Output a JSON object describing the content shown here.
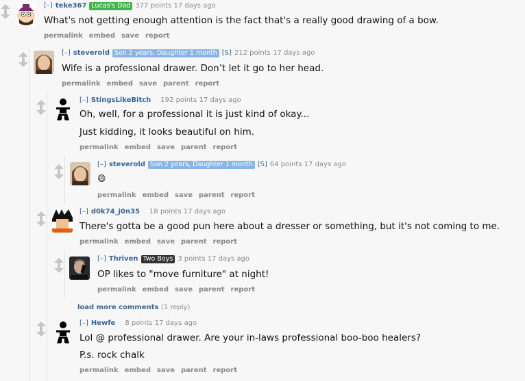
{
  "actions": {
    "permalink": "permalink",
    "embed": "embed",
    "save": "save",
    "parent": "parent",
    "report": "report"
  },
  "collapse": "[–]",
  "comments": [
    {
      "author": "teke367",
      "flair": "Lucas's Dad",
      "flair_color": "#46b34a",
      "score": "377 points 17 days ago",
      "lines": [
        "What's not getting enough attention is the fact that's a really good drawing of a bow."
      ],
      "avatar": "south-park-avatar"
    },
    {
      "author": "steverold",
      "flair": "Son 2 years, Daughter 1 month",
      "flair_color": "#89b4e6",
      "submitter": "[S]",
      "score": "212 points 17 days ago",
      "lines": [
        "Wife is a professional drawer. Don’t let it go to her head."
      ],
      "avatar": "man-portrait-avatar"
    },
    {
      "author": "StingsLikeBitch",
      "score": "192 points 17 days ago",
      "lines": [
        "Oh, well, for a professional it is just kind of okay...",
        "Just kidding, it looks beautiful on him."
      ],
      "avatar": "baby-icon"
    },
    {
      "author": "steverold",
      "flair": "Son 2 years, Daughter 1 month",
      "flair_color": "#89b4e6",
      "submitter": "[S]",
      "score": "64 points 17 days ago",
      "lines": [
        "😄"
      ],
      "avatar": "man-portrait-avatar"
    },
    {
      "author": "d0k74_j0n35",
      "score": "18 points 17 days ago",
      "lines": [
        "There's gotta be a good pun here about a dresser or something, but it's not coming to me."
      ],
      "avatar": "anime-avatar"
    },
    {
      "author": "Thriven",
      "flair": "Two Boys",
      "flair_color": "#333333",
      "score": "3 points 17 days ago",
      "lines": [
        "OP likes to \"move furniture\" at night!"
      ],
      "avatar": "phone-man-avatar"
    },
    {
      "author": "Hewfe",
      "score": "8 points 17 days ago",
      "lines": [
        "Lol @ professional drawer. Are your in-laws professional boo-boo healers?",
        "P.s. rock chalk"
      ],
      "avatar": "baby-icon"
    }
  ],
  "load_more": {
    "label": "load more comments",
    "count": "(1 reply)"
  }
}
